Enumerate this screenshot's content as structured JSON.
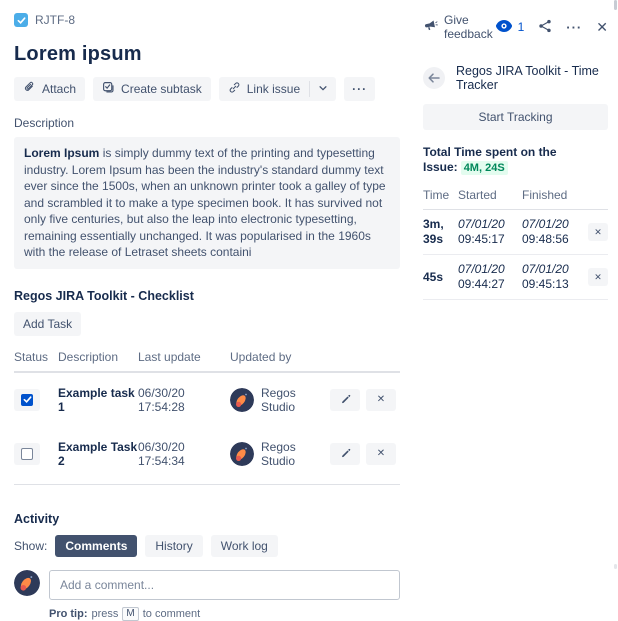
{
  "breadcrumb": {
    "issue_key": "RJTF-8"
  },
  "issue": {
    "title": "Lorem ipsum"
  },
  "toolbar": {
    "attach": "Attach",
    "create_subtask": "Create subtask",
    "link_issue": "Link issue"
  },
  "description": {
    "label": "Description",
    "bold_lead": "Lorem Ipsum",
    "body": " is simply dummy text of the printing and typesetting industry. Lorem Ipsum has been the industry's standard dummy text ever since the 1500s, when an unknown printer took a galley of type and scrambled it to make a type specimen book. It has survived not only five centuries, but also the leap into electronic typesetting, remaining essentially unchanged. It was popularised in the 1960s with the release of Letraset sheets containi"
  },
  "checklist": {
    "title": "Regos JIRA Toolkit - Checklist",
    "add_task_label": "Add Task",
    "columns": [
      "Status",
      "Description",
      "Last update",
      "Updated by"
    ],
    "rows": [
      {
        "checked": true,
        "description": "Example task 1",
        "last_update": "06/30/20 17:54:28",
        "updated_by": "Regos Studio"
      },
      {
        "checked": false,
        "description": "Example Task 2",
        "last_update": "06/30/20 17:54:34",
        "updated_by": "Regos Studio"
      }
    ]
  },
  "activity": {
    "title": "Activity",
    "show_label": "Show:",
    "tabs": [
      {
        "label": "Comments",
        "active": true
      },
      {
        "label": "History",
        "active": false
      },
      {
        "label": "Work log",
        "active": false
      }
    ],
    "comment_placeholder": "Add a comment...",
    "pro_tip": {
      "lead": "Pro tip:",
      "before_key": "press",
      "key": "M",
      "after_key": "to comment"
    }
  },
  "panel": {
    "feedback_label": "Give feedback",
    "watchers_count": "1",
    "tracker_title": "Regos JIRA Toolkit - Time Tracker",
    "start_button": "Start Tracking",
    "total_label": "Total Time spent on the Issue:",
    "total_value": "4M, 24S",
    "columns": [
      "Time",
      "Started",
      "Finished"
    ],
    "rows": [
      {
        "time_line1": "3m,",
        "time_line2": "39s",
        "started_date": "07/01/20",
        "started_time": "09:45:17",
        "finished_date": "07/01/20",
        "finished_time": "09:48:56"
      },
      {
        "time_line1": "45s",
        "time_line2": "",
        "started_date": "07/01/20",
        "started_time": "09:44:27",
        "finished_date": "07/01/20",
        "finished_time": "09:45:13"
      }
    ]
  },
  "icons": {
    "more_glyph": "···",
    "close_glyph": "✕",
    "delete_glyph": "✕"
  },
  "colors": {
    "accent_blue": "#0052CC",
    "task_icon_blue": "#4BADE8",
    "success_green": "#00875A",
    "success_bg": "#E3FCEF",
    "active_tab_bg": "#42526E",
    "button_bg": "#F4F5F7"
  }
}
